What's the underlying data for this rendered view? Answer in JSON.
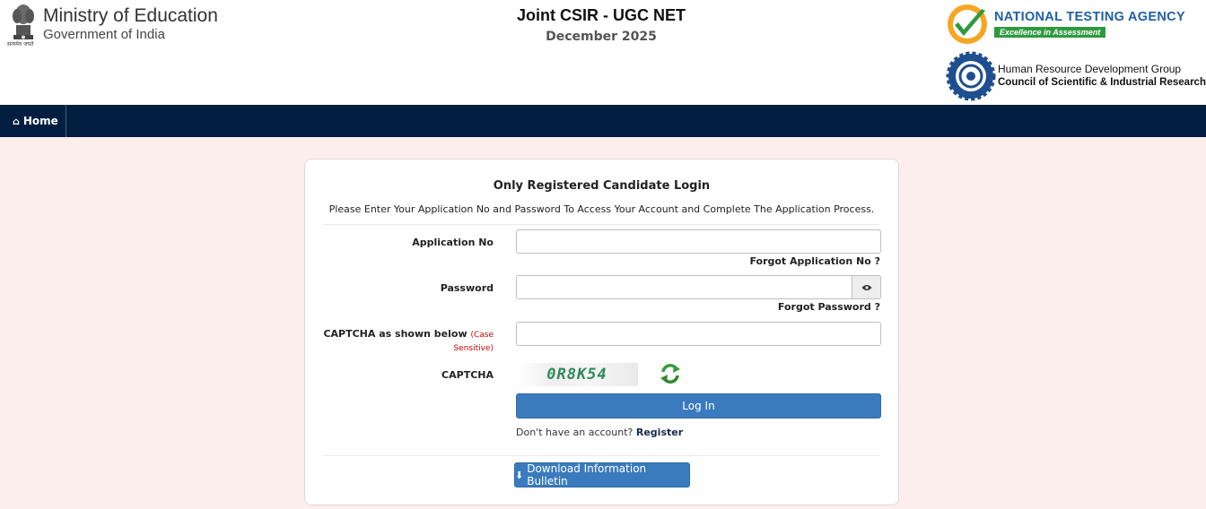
{
  "header": {
    "emblem_caption": "सत्यमेव जयते",
    "ministry_line1": "Ministry of Education",
    "ministry_line2": "Government of India",
    "exam_title": "Joint CSIR - UGC NET",
    "exam_session": "December 2025",
    "nta_name": "NATIONAL TESTING AGENCY",
    "nta_tagline": "Excellence in Assessment",
    "hrdg_line1": "Human Resource Development Group",
    "hrdg_line2": "Council of Scientific & Industrial Research"
  },
  "nav": {
    "home_label": "Home",
    "home_icon": "home-icon"
  },
  "login": {
    "title": "Only Registered Candidate Login",
    "subtitle": "Please Enter Your Application No and Password To Access Your Account and Complete The Application Process.",
    "application_label": "Application No",
    "application_value": "",
    "forgot_application": "Forgot Application No ?",
    "password_label": "Password",
    "password_value": "",
    "forgot_password": "Forgot Password ?",
    "captcha_input_label": "CAPTCHA as shown below",
    "captcha_case_note1": "(Case",
    "captcha_case_note2": "Sensitive)",
    "captcha_value": "",
    "captcha_label": "CAPTCHA",
    "captcha_text": "0R8K54",
    "login_button": "Log In",
    "no_account_text": "Don't have an account?",
    "register_link": "Register",
    "download_button": "Download Information Bulletin"
  },
  "colors": {
    "nav_bg": "#011e41",
    "page_bg": "#fdeeee",
    "primary_button": "#3a7bbd",
    "nta_blue": "#1f5fa8",
    "nta_green": "#2e9a3e",
    "case_red": "#cc0000",
    "captcha_green": "#2e8b57"
  }
}
